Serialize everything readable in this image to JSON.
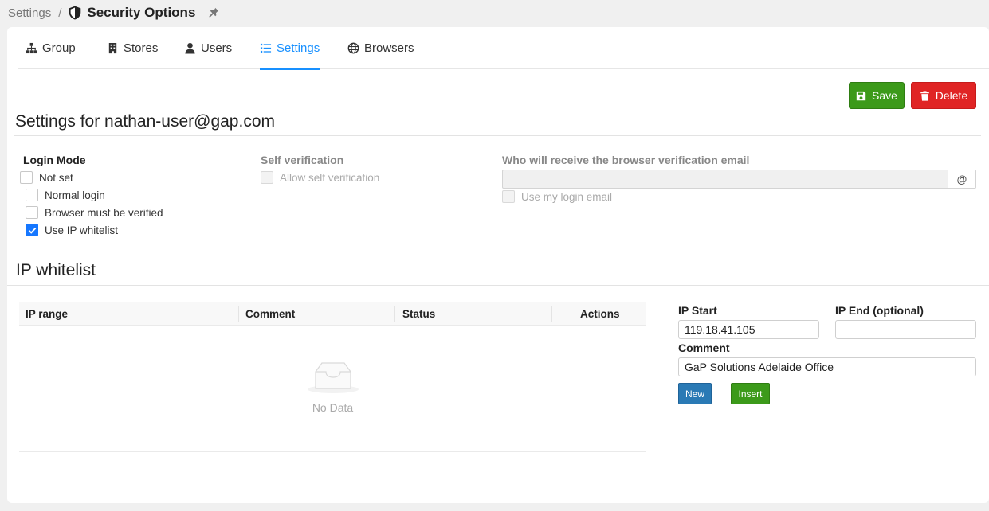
{
  "breadcrumb": {
    "parent": "Settings",
    "separator": "/",
    "title": "Security Options"
  },
  "tabs": [
    {
      "label": "Group",
      "icon": "sitemap-icon"
    },
    {
      "label": "Stores",
      "icon": "building-icon"
    },
    {
      "label": "Users",
      "icon": "user-icon"
    },
    {
      "label": "Settings",
      "icon": "list-icon",
      "active": true
    },
    {
      "label": "Browsers",
      "icon": "globe-icon"
    }
  ],
  "toolbar": {
    "save_label": "Save",
    "delete_label": "Delete"
  },
  "settings": {
    "heading": "Settings for nathan-user@gap.com",
    "login_mode": {
      "label": "Login Mode",
      "options": [
        {
          "label": "Not set",
          "checked": false
        },
        {
          "label": "Normal login",
          "checked": false
        },
        {
          "label": "Browser must be verified",
          "checked": false
        },
        {
          "label": "Use IP whitelist",
          "checked": true
        }
      ]
    },
    "self_verification": {
      "label": "Self verification",
      "option_label": "Allow self verification"
    },
    "verification_email": {
      "label": "Who will receive the browser verification email",
      "value": "",
      "addon": "@",
      "use_login_label": "Use my login email"
    }
  },
  "ip_whitelist": {
    "heading": "IP whitelist",
    "columns": [
      "IP range",
      "Comment",
      "Status",
      "Actions"
    ],
    "rows": [],
    "empty_text": "No Data",
    "form": {
      "ip_start_label": "IP Start",
      "ip_start_value": "119.18.41.105",
      "ip_end_label": "IP End (optional)",
      "ip_end_value": "",
      "comment_label": "Comment",
      "comment_value": "GaP Solutions Adelaide Office",
      "new_label": "New",
      "insert_label": "Insert"
    }
  },
  "colors": {
    "accent": "#1890ff",
    "save": "#3c9a1a",
    "delete": "#e02424",
    "new": "#2a7ab5"
  }
}
